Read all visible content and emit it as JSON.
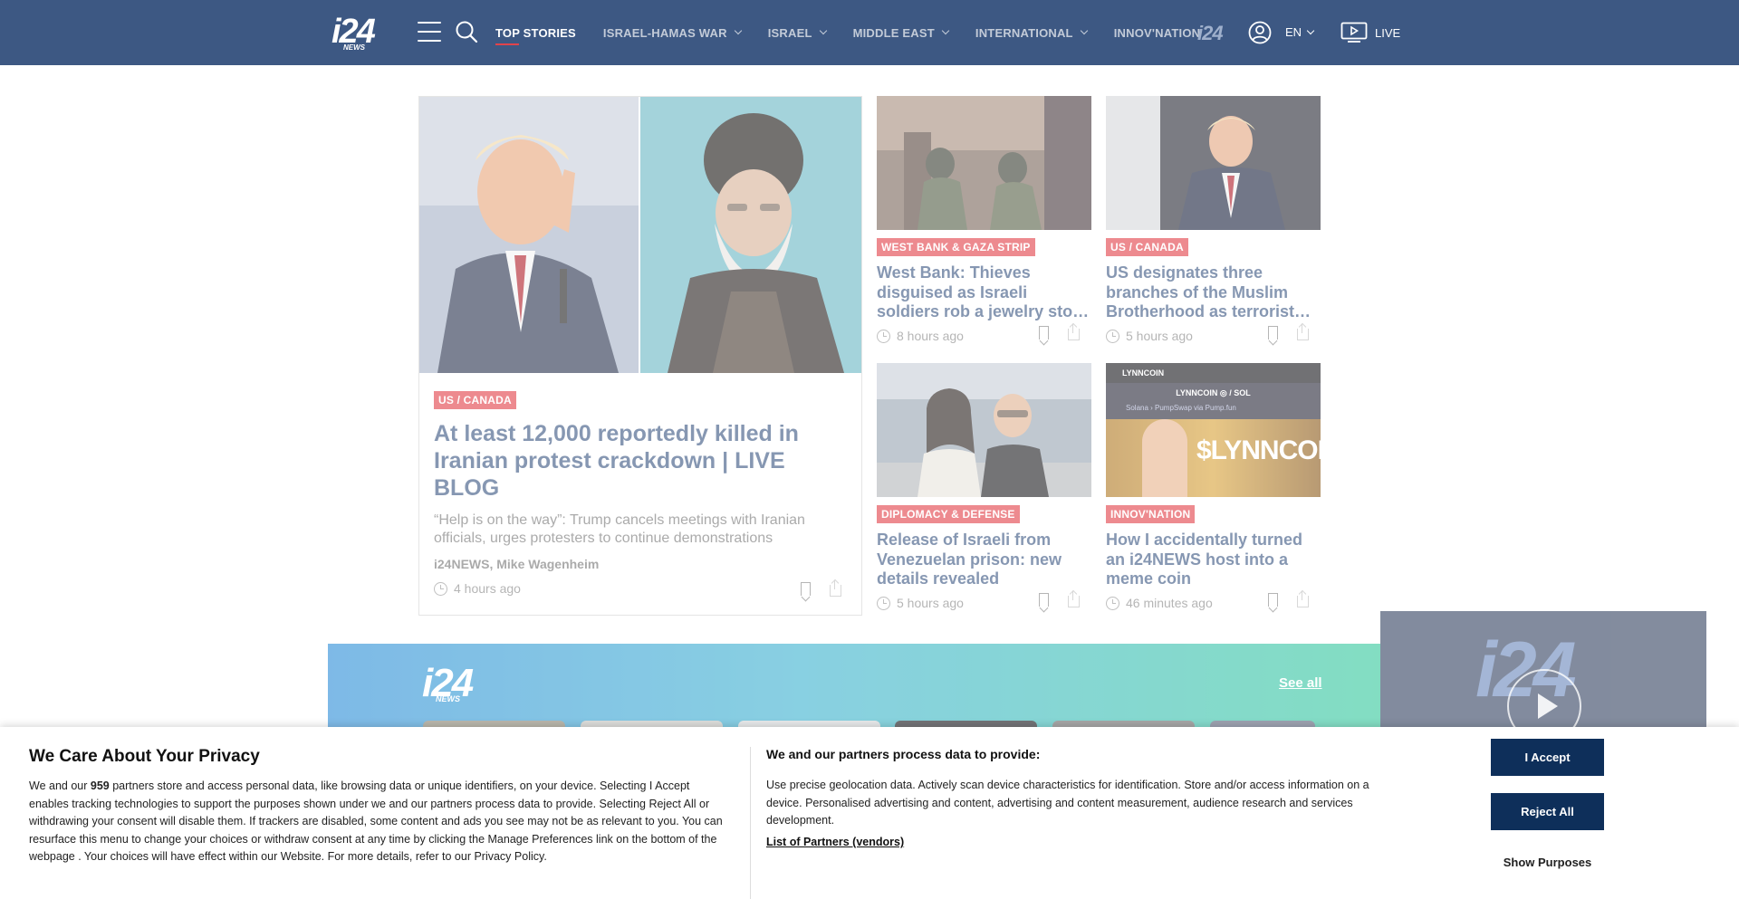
{
  "header": {
    "logo": "i24",
    "logo_sub": "NEWS",
    "nav": [
      {
        "label": "TOP STORIES",
        "active": true,
        "dropdown": false
      },
      {
        "label": "ISRAEL-HAMAS WAR",
        "active": false,
        "dropdown": true
      },
      {
        "label": "ISRAEL",
        "active": false,
        "dropdown": true
      },
      {
        "label": "MIDDLE EAST",
        "active": false,
        "dropdown": true
      },
      {
        "label": "INTERNATIONAL",
        "active": false,
        "dropdown": true
      },
      {
        "label": "INNOV'NATION",
        "active": false,
        "dropdown": false
      }
    ],
    "plus_logo": "i24",
    "lang": "EN",
    "live": "LIVE",
    "colors": {
      "bar": "#3d5883",
      "accent": "#e2434b"
    }
  },
  "feature": {
    "tag": "US / CANADA",
    "title": "At least 12,000 reportedly killed in Iranian protest crackdown | LIVE BLOG",
    "desc": "“Help is on the way”: Trump cancels meetings with Iranian officials, urges protesters to continue demonstrations",
    "author": "i24NEWS, Mike Wagenheim",
    "time": "4 hours ago"
  },
  "cards": [
    {
      "tag": "WEST BANK & GAZA STRIP",
      "title": "West Bank: Thieves disguised as Israeli soldiers rob a jewelry sto…",
      "time": "8 hours ago"
    },
    {
      "tag": "US / CANADA",
      "title": "US designates three branches of the Muslim Brotherhood as terrorist…",
      "time": "5 hours ago"
    },
    {
      "tag": "DIPLOMACY & DEFENSE",
      "title": "Release of Israeli from Venezuelan prison: new details revealed",
      "time": "5 hours ago"
    },
    {
      "tag": "INNOV'NATION",
      "title": "How I accidentally turned an i24NEWS host into a meme coin",
      "time": "46 minutes ago",
      "img_text": "LYNNCOIN",
      "img_text2": "$LYNNCOIN",
      "img_text3": "LYNNCOIN ◎ / SOL",
      "img_text4": "Solana › PumpSwap via Pump.fun"
    }
  ],
  "strip": {
    "logo": "i24",
    "logo_sub": "NEWS",
    "see_all": "See all"
  },
  "player": {
    "logo": "i24"
  },
  "consent": {
    "title": "We Care About Your Privacy",
    "body_1": "We and our ",
    "partners_count": "959",
    "body_2": " partners store and access personal data, like browsing data or unique identifiers, on your device. Selecting I Accept enables tracking technologies to support the purposes shown under we and our partners process data to provide. Selecting Reject All or withdrawing your consent will disable them. If trackers are disabled, some content and ads you see may not be as relevant to you. You can resurface this menu to change your choices or withdraw consent at any time by clicking the Manage Preferences link on the bottom of the webpage . Your choices will have effect within our Website. For more details, refer to our Privacy Policy.",
    "subtitle": "We and our partners process data to provide:",
    "purposes": "Use precise geolocation data. Actively scan device characteristics for identification. Store and/or access information on a device. Personalised advertising and content, advertising and content measurement, audience research and services development.",
    "vendors_link": "List of Partners (vendors)",
    "accept": "I Accept",
    "reject": "Reject All",
    "show_purposes": "Show Purposes"
  }
}
